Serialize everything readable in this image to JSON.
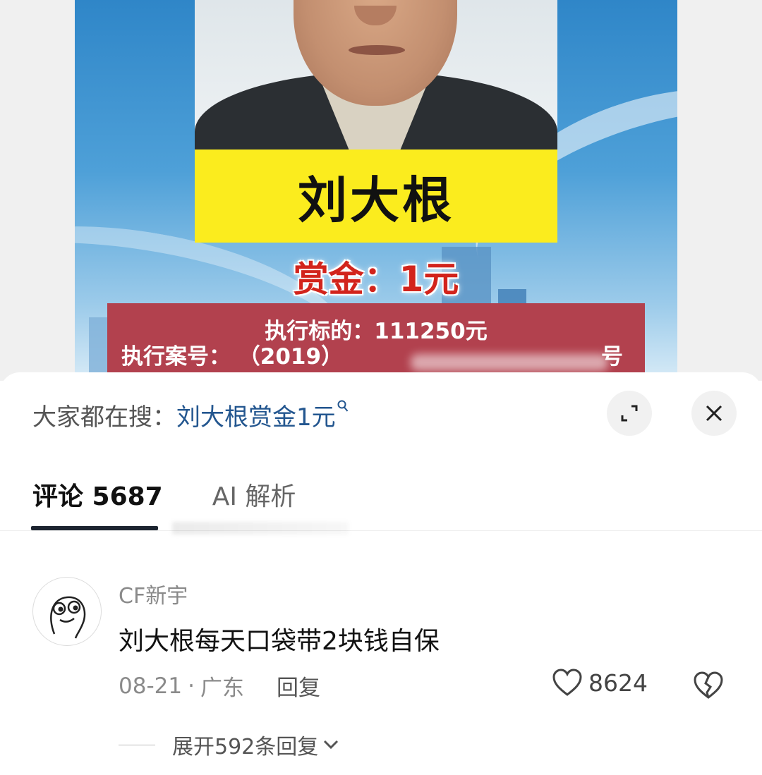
{
  "poster": {
    "name": "刘大根",
    "bounty_label": "赏金：",
    "bounty_value": "1元",
    "target_label": "执行标的：",
    "target_value": "111250元",
    "case_label": "执行案号：",
    "case_value": "（2019）",
    "case_suffix": "号"
  },
  "search_bar": {
    "prefix": "大家都在搜：",
    "term": "刘大根赏金1元",
    "icon": "search-icon"
  },
  "controls": {
    "expand_icon": "expand-icon",
    "close_icon": "close-icon"
  },
  "tabs": {
    "comments": "评论 5687",
    "ai": "AI 解析"
  },
  "comment": {
    "username": "CF新宇",
    "text": "刘大根每天口袋带2块钱自保",
    "date": "08-21",
    "separator": "·",
    "location": "广东",
    "reply_label": "回复",
    "like_count": "8624",
    "expand_replies": "展开592条回复"
  },
  "colors": {
    "accent_link": "#23568f",
    "name_box": "#fbec1e",
    "bounty_red": "#d2241c",
    "case_box": "#b2414e"
  }
}
